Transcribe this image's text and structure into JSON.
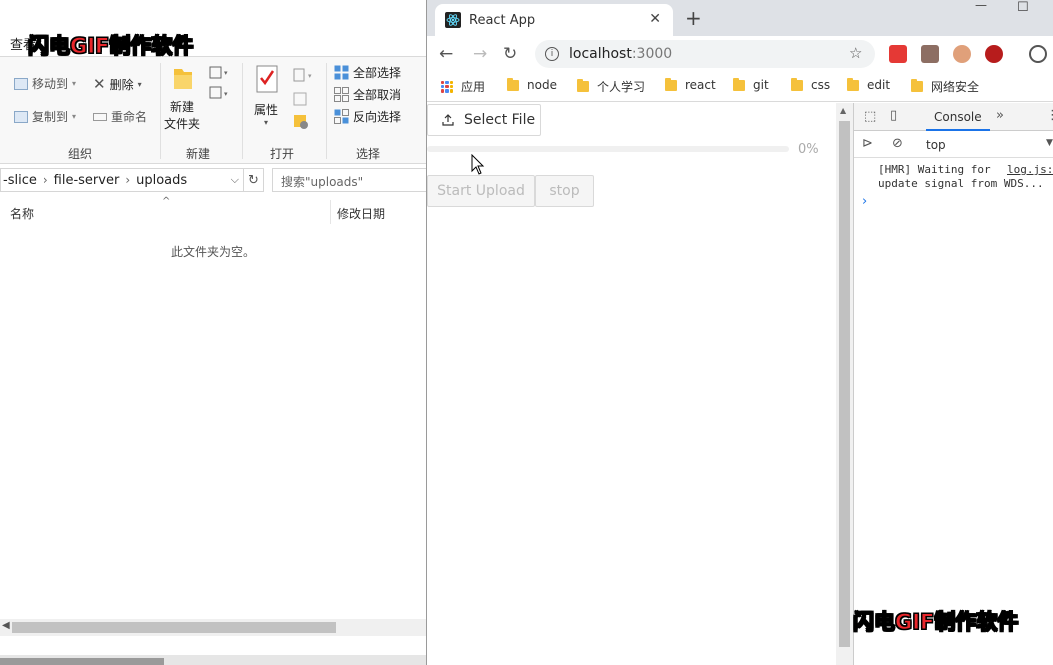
{
  "explorer": {
    "ribbon_tab": "查看",
    "ribbon": {
      "move_to": "移动到",
      "copy_to": "复制到",
      "delete": "删除",
      "rename": "重命名",
      "new_folder_line1": "新建",
      "new_folder_line2": "文件夹",
      "properties": "属性",
      "select_all": "全部选择",
      "select_none": "全部取消",
      "invert_selection": "反向选择",
      "groups": {
        "organize": "组织",
        "new": "新建",
        "open": "打开",
        "select": "选择"
      }
    },
    "address": {
      "segments": [
        "-slice",
        "file-server",
        "uploads"
      ]
    },
    "search_placeholder": "搜索\"uploads\"",
    "columns": {
      "name": "名称",
      "date": "修改日期"
    },
    "empty_message": "此文件夹为空。"
  },
  "watermark": {
    "red": "闪电GIF",
    "white": "制作软件"
  },
  "browser": {
    "tab_title": "React App",
    "url_host": "localhost",
    "url_port": ":3000",
    "bookmarks": [
      {
        "label": "应用",
        "icon": "apps-grid-icon"
      },
      {
        "label": "node",
        "icon": "folder-icon"
      },
      {
        "label": "个人学习",
        "icon": "folder-icon"
      },
      {
        "label": "react",
        "icon": "folder-icon"
      },
      {
        "label": "git",
        "icon": "folder-icon"
      },
      {
        "label": "css",
        "icon": "folder-icon"
      },
      {
        "label": "edit",
        "icon": "folder-icon"
      },
      {
        "label": "网络安全",
        "icon": "folder-icon"
      }
    ]
  },
  "app": {
    "select_file_label": "Select File",
    "progress_percent": 0,
    "progress_label": "0%",
    "start_upload_label": "Start Upload",
    "stop_label": "stop"
  },
  "devtools": {
    "active_tab": "Console",
    "context": "top",
    "log_line1": "[HMR] Waiting for",
    "log_line2": "update signal from WDS...",
    "log_source": "log.js:"
  },
  "colors": {
    "accent": "#1890ff",
    "folder": "#f5c13b",
    "watermark_red": "#e8262b"
  }
}
